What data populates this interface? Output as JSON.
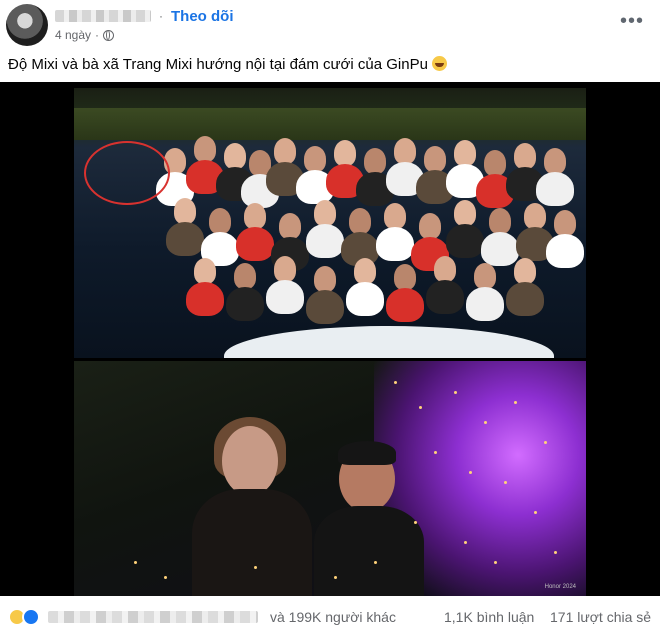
{
  "header": {
    "follow_label": "Theo dõi",
    "time": "4 ngày",
    "separator": "·"
  },
  "post": {
    "caption": "Độ Mixi và bà xã Trang Mixi hướng nội tại đám cưới của GinPu"
  },
  "footer": {
    "reaction_summary": "và 199K người khác",
    "comments": "1,1K bình luận",
    "shares": "171 lượt chia sẻ"
  },
  "icons": {
    "more": "more-icon",
    "privacy": "globe-icon",
    "caption_emoji": "rofl-emoji-icon",
    "reactions": [
      "haha-icon",
      "like-icon"
    ]
  },
  "colors": {
    "follow_link": "#1b74e4",
    "highlight_circle": "#d8322f",
    "secondary_text": "#65676b"
  }
}
